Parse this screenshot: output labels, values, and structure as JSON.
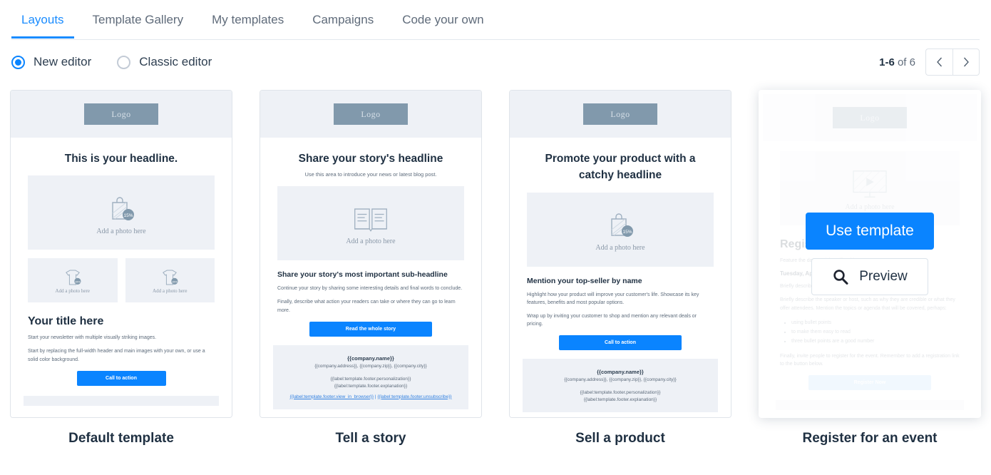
{
  "tabs": [
    {
      "label": "Layouts",
      "active": true
    },
    {
      "label": "Template Gallery",
      "active": false
    },
    {
      "label": "My templates",
      "active": false
    },
    {
      "label": "Campaigns",
      "active": false
    },
    {
      "label": "Code your own",
      "active": false
    }
  ],
  "editor_options": [
    {
      "label": "New editor",
      "selected": true
    },
    {
      "label": "Classic editor",
      "selected": false
    }
  ],
  "pagination": {
    "range": "1-6",
    "of": "of 6",
    "prev_icon": "chevron-left-icon",
    "next_icon": "chevron-right-icon"
  },
  "hover_overlay": {
    "use_template_label": "Use template",
    "preview_label": "Preview",
    "preview_icon": "search-icon"
  },
  "colors": {
    "accent": "#0a84ff",
    "tab_active": "#1a8cff",
    "text": "#1f3042",
    "muted": "#5d6b7b",
    "placeholder_bg": "#eef1f6",
    "logo_bg": "#8199ac"
  },
  "common": {
    "logo_label": "Logo",
    "add_photo": "Add a photo here",
    "footer_company_name": "{{company.name}}",
    "footer_address": "{{company.address}}, {{company.zip}}, {{company.city}}",
    "footer_personalization": "{{label:template.footer.personalization}}",
    "footer_explanation": "{{label:template.footer.explanation}}",
    "footer_view_in_browser": "{{label:template.footer.view_in_browser}}",
    "footer_separator": " | ",
    "footer_unsubscribe": "{{label:template.footer.unsubscribe}}"
  },
  "cards": [
    {
      "title": "Default template",
      "hovered": false,
      "headline": "This is your headline.",
      "subheading": "",
      "photo_icon": "shopping-bag-icon",
      "section_title": "Your title here",
      "paragraph1": "Start your newsletter with multiple visually striking images.",
      "paragraph2": "Start by replacing the full-width header and main images with your own, or use a solid color background.",
      "cta": "Call to action"
    },
    {
      "title": "Tell a story",
      "hovered": false,
      "headline": "Share your story's headline",
      "subheading": "Use this area to introduce your news or latest blog post.",
      "photo_icon": "open-book-icon",
      "section_title": "Share your story's most important sub-headline",
      "paragraph1": "Continue your story by sharing some interesting details and final words to conclude.",
      "paragraph2": "Finally, describe what action your readers can take or where they can go to learn more.",
      "cta": "Read the whole story"
    },
    {
      "title": "Sell a product",
      "hovered": false,
      "headline": "Promote your product with a catchy headline",
      "subheading": "",
      "photo_icon": "shopping-bag-icon",
      "section_title": "Mention your top-seller by name",
      "paragraph1": "Highlight how your product will improve your customer's life. Showcase its key features, benefits and most popular options.",
      "paragraph2": "Wrap up by inviting your customer to shop and mention any relevant deals or pricing.",
      "cta": "Call to action"
    },
    {
      "title": "Register for an event",
      "hovered": true,
      "headline": "",
      "subheading": "",
      "photo_icon": "monitor-play-icon",
      "section_title": "Register for an event",
      "date_intro": "Feature the date and time, like this:",
      "date_line": "Tuesday, April 13, 2021 at 2pm",
      "paragraph1": "Briefly describe the event and what attendees will learn or gain.",
      "paragraph2": "Briefly describe the speaker or host, such as why they are credible or what they offer attendees. Mention the topics or agenda that will be covered, perhaps:",
      "bullets": [
        "using bullet points",
        "to make them easy to read",
        "three bullet points are a good number"
      ],
      "paragraph3": "Finally, invite people to register for the event. Remember to add a registration link to the button below.",
      "cta": "Register Now"
    }
  ]
}
